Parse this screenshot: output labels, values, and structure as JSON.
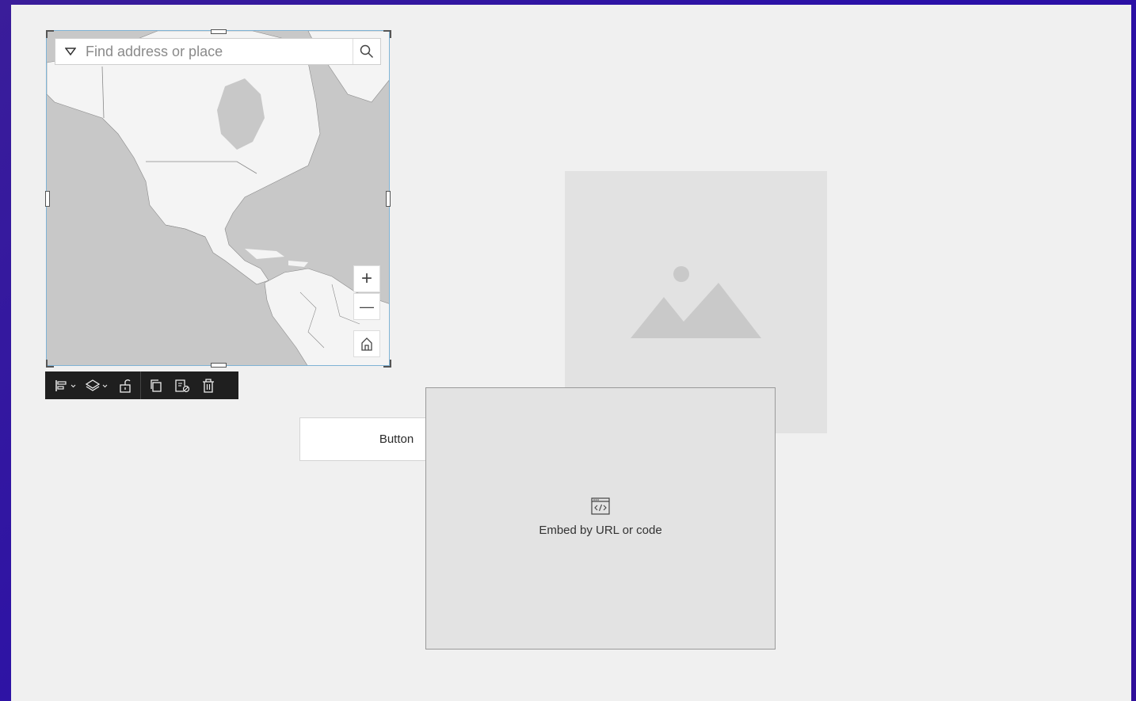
{
  "map": {
    "search_placeholder": "Find address or place",
    "zoom_in": "+",
    "zoom_out": "—"
  },
  "button_widget": {
    "label": "Button"
  },
  "embed_widget": {
    "label": "Embed by URL or code"
  },
  "colors": {
    "background_gradient": "#2a10a8",
    "canvas": "#f0f0f0",
    "toolbar": "#1f1f1f",
    "selection_border": "#7fb3d5"
  },
  "icons": {
    "toolbar": [
      "align-icon",
      "layers-icon",
      "unlock-icon",
      "duplicate-icon",
      "edit-page-icon",
      "trash-icon"
    ],
    "map": [
      "dropdown-icon",
      "search-icon",
      "home-icon"
    ]
  }
}
